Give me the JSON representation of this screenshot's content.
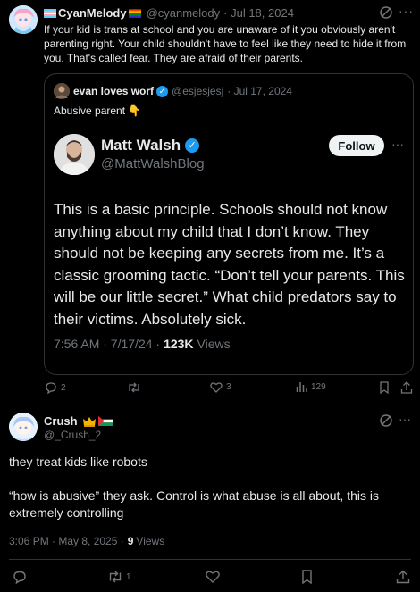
{
  "post1": {
    "display_name": "CyanMelody",
    "handle": "@cyanmelody",
    "date": "· Jul 18, 2024",
    "text": "If your kid is trans at school and you are unaware of it you obviously aren't parenting right. Your child shouldn't have to feel like they need to hide it from you. That's called fear. They are afraid of their parents.",
    "quote": {
      "display_name": "evan loves worf",
      "handle": "@esjesjesj",
      "date": "· Jul 17, 2024",
      "text": "Abusive parent",
      "emoji": "👇",
      "embed": {
        "display_name": "Matt Walsh",
        "handle": "@MattWalshBlog",
        "follow_label": "Follow",
        "text": "This is a basic principle. Schools should not know anything about my child that I don’t know. They should not be keeping any secrets from me. It’s a classic grooming tactic. “Don’t tell your parents. This will be our little secret.” What child predators say to their victims. Absolutely sick.",
        "time": "7:56 AM · 7/17/24 ·",
        "views_count": "123K",
        "views_label": "Views"
      }
    },
    "actions": {
      "replies": "2",
      "reposts": "",
      "likes": "3",
      "views": "129"
    }
  },
  "post2": {
    "display_name": "Crush",
    "handle": "@_Crush_2",
    "body_1": "they treat kids like robots",
    "body_2": "“how is abusive” they ask. Control is what abuse is all about, this is extremely controlling",
    "time": "3:06 PM · May 8, 2025 ·",
    "views_count": "9",
    "views_label": "Views",
    "actions": {
      "reposts": "1"
    }
  },
  "colors": {
    "background": "#000000",
    "text": "#e7e9ea",
    "muted": "#71767b",
    "border": "#2f3336",
    "verified": "#1d9bf0"
  }
}
